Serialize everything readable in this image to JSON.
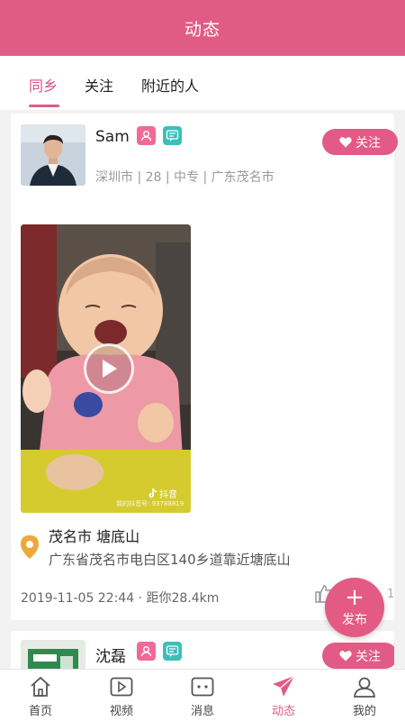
{
  "header": {
    "title": "动态"
  },
  "tabs": [
    {
      "label": "同乡",
      "active": true
    },
    {
      "label": "关注",
      "active": false
    },
    {
      "label": "附近的人",
      "active": false
    }
  ],
  "posts": [
    {
      "username": "Sam",
      "follow_label": "关注",
      "meta": "深圳市 | 28 | 中专 | 广东茂名市",
      "video_watermark": "抖音",
      "video_id": "我的抖音号: 93788819",
      "location_name": "茂名市 塘底山",
      "location_address": "广东省茂名市电白区140乡道靠近塘底山",
      "time_distance": "2019-11-05 22:44 · 距你28.4km",
      "like_count": "1"
    },
    {
      "username": "沈磊",
      "follow_label": "关注"
    }
  ],
  "fab": {
    "plus": "+",
    "label": "发布"
  },
  "nav": [
    {
      "label": "首页",
      "icon": "home-icon"
    },
    {
      "label": "视频",
      "icon": "video-icon"
    },
    {
      "label": "消息",
      "icon": "message-icon"
    },
    {
      "label": "动态",
      "icon": "send-icon",
      "active": true
    },
    {
      "label": "我的",
      "icon": "user-icon"
    }
  ],
  "colors": {
    "brand": "#e05c86",
    "chat_badge": "#3bbfb8",
    "location_pin": "#f0a73a"
  }
}
